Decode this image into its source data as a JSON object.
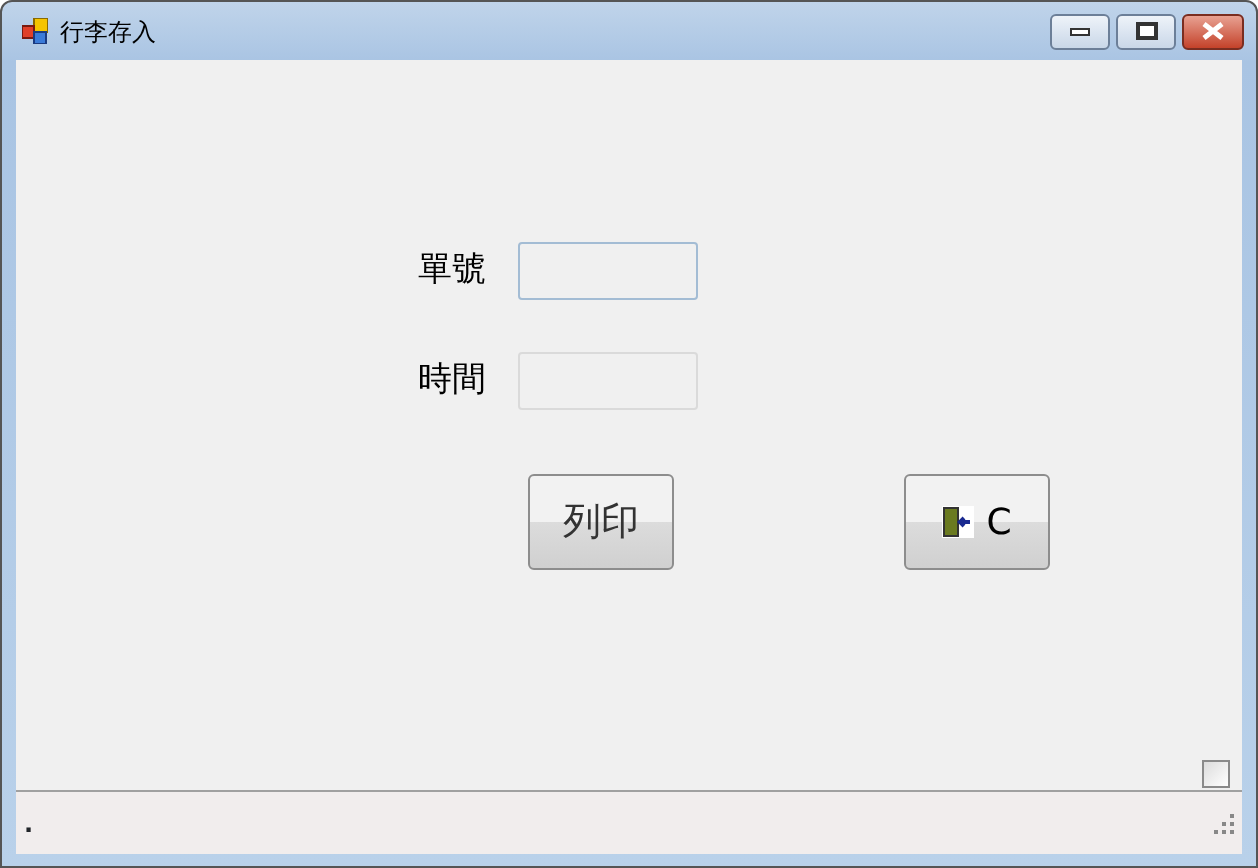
{
  "window": {
    "title": "行李存入"
  },
  "fields": [
    {
      "label": "單號",
      "disabled": false
    },
    {
      "label": "時間",
      "disabled": true
    }
  ],
  "buttons": [
    {
      "kind": "text",
      "label": "列印"
    },
    {
      "kind": "exit",
      "label": "C"
    }
  ],
  "checkbox": {
    "checked": false
  },
  "status_bar": {
    "text": "."
  }
}
